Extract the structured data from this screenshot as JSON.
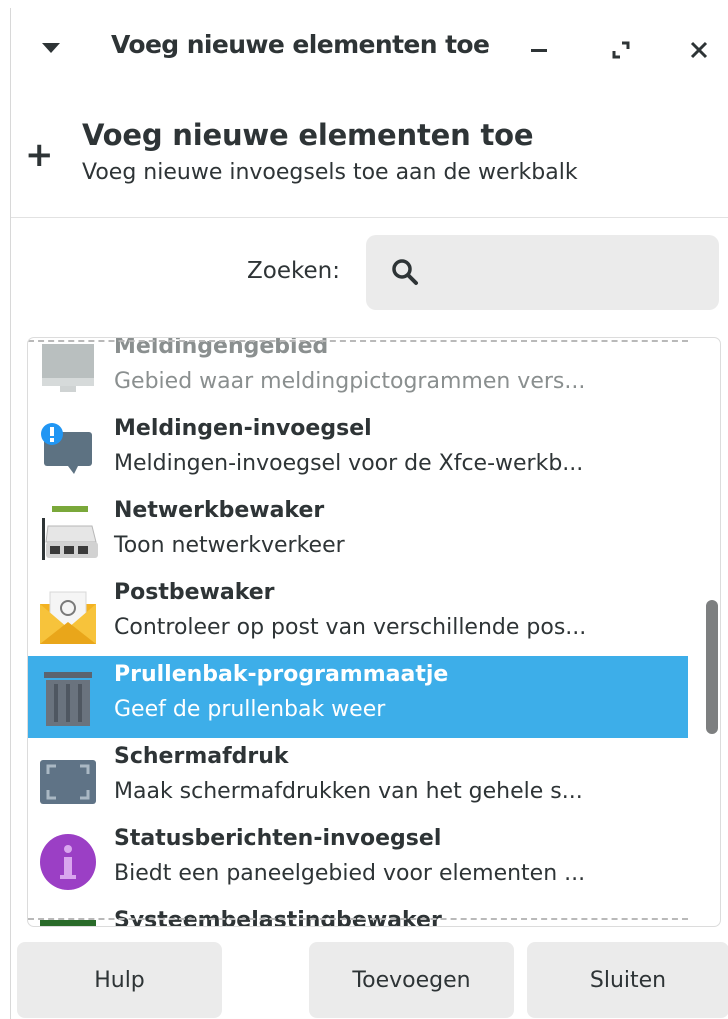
{
  "window": {
    "title": "Voeg nieuwe elementen toe"
  },
  "header": {
    "plus_glyph": "+",
    "title": "Voeg nieuwe elementen toe",
    "subtitle": "Voeg nieuwe invoegsels toe aan de werkbalk"
  },
  "search": {
    "label": "Zoeken:",
    "value": ""
  },
  "plugins": [
    {
      "name": "Meldingengebied",
      "description": "Gebied waar meldingpictogrammen vers...",
      "icon": "notification-area-icon",
      "faded": true,
      "selected": false
    },
    {
      "name": "Meldingen-invoegsel",
      "description": "Meldingen-invoegsel voor de Xfce-werkb...",
      "icon": "notification-plugin-icon",
      "faded": false,
      "selected": false
    },
    {
      "name": "Netwerkbewaker",
      "description": "Toon netwerkverkeer",
      "icon": "network-monitor-icon",
      "faded": false,
      "selected": false
    },
    {
      "name": "Postbewaker",
      "description": "Controleer op post van verschillende pos...",
      "icon": "mail-watcher-icon",
      "faded": false,
      "selected": false
    },
    {
      "name": "Prullenbak-programmaatje",
      "description": "Geef de prullenbak weer",
      "icon": "trash-icon",
      "faded": false,
      "selected": true
    },
    {
      "name": "Schermafdruk",
      "description": "Maak schermafdrukken van het gehele s...",
      "icon": "screenshot-icon",
      "faded": false,
      "selected": false
    },
    {
      "name": "Statusberichten-invoegsel",
      "description": "Biedt een paneelgebied voor elementen ...",
      "icon": "status-notifier-icon",
      "faded": false,
      "selected": false
    },
    {
      "name": "Systeembelastingbewaker",
      "description": "",
      "icon": "system-load-icon",
      "faded": false,
      "selected": false
    }
  ],
  "buttons": {
    "help": "Hulp",
    "add": "Toevoegen",
    "close": "Sluiten"
  },
  "colors": {
    "selection": "#3daee9",
    "button_bg": "#ebebeb",
    "text": "#2e3436"
  }
}
